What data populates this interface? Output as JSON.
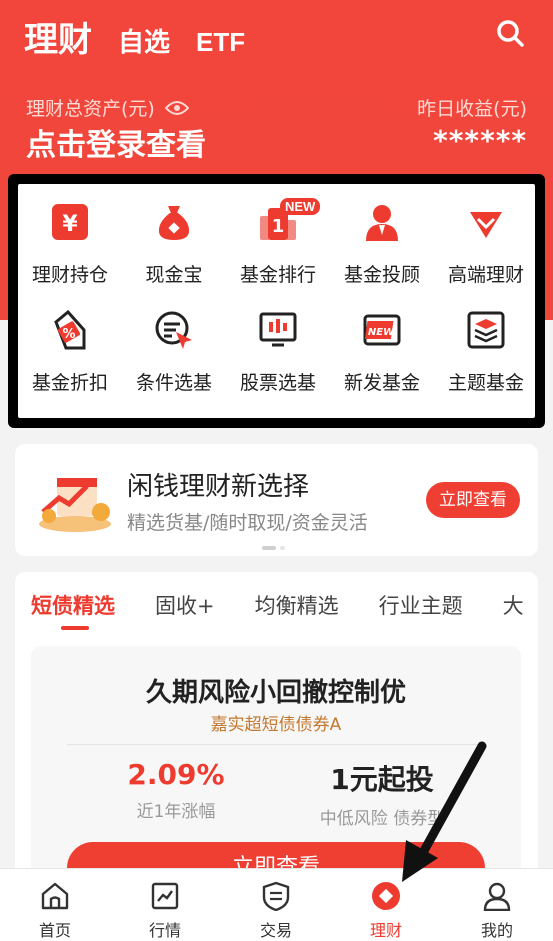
{
  "header": {
    "tabs": [
      "理财",
      "自选",
      "ETF"
    ],
    "asset_label": "理财总资产(元)",
    "login_prompt": "点击登录查看",
    "yesterday_label": "昨日收益(元)",
    "yesterday_value": "******"
  },
  "menu": {
    "items": [
      {
        "label": "理财持仓",
        "icon": "yen-box-icon"
      },
      {
        "label": "现金宝",
        "icon": "money-bag-icon"
      },
      {
        "label": "基金排行",
        "icon": "ranking-icon",
        "badge": "NEW"
      },
      {
        "label": "基金投顾",
        "icon": "advisor-icon"
      },
      {
        "label": "高端理财",
        "icon": "diamond-icon"
      },
      {
        "label": "基金折扣",
        "icon": "discount-tag-icon"
      },
      {
        "label": "条件选基",
        "icon": "filter-cursor-icon"
      },
      {
        "label": "股票选基",
        "icon": "stock-chart-icon"
      },
      {
        "label": "新发基金",
        "icon": "new-tag-icon"
      },
      {
        "label": "主题基金",
        "icon": "layers-icon"
      }
    ]
  },
  "banner": {
    "title": "闲钱理财新选择",
    "subtitle": "精选货基/随时取现/资金灵活",
    "button": "立即查看"
  },
  "categories": {
    "tabs": [
      "短债精选",
      "固收+",
      "均衡精选",
      "行业主题",
      "大"
    ],
    "active_index": 0
  },
  "product": {
    "title": "久期风险小回撤控制优",
    "fund_name": "嘉实超短债债券A",
    "return_value": "2.09%",
    "return_label": "近1年涨幅",
    "min_invest": "1元起投",
    "risk_label": "中低风险 债券型",
    "cta": "立即查看"
  },
  "bottom_nav": {
    "items": [
      "首页",
      "行情",
      "交易",
      "理财",
      "我的"
    ],
    "active_index": 3
  },
  "colors": {
    "brand_red": "#ee3b2f",
    "header_red": "#f2453b",
    "gold": "#c4782f"
  }
}
